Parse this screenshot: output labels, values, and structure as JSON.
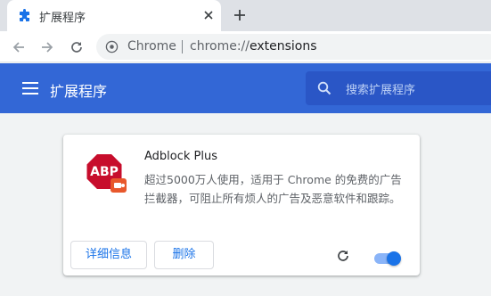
{
  "tab": {
    "title": "扩展程序"
  },
  "address_bar": {
    "chip_label": "Chrome",
    "url_scheme": "chrome://",
    "url_path": "extensions"
  },
  "extensions_page": {
    "title": "扩展程序",
    "search_placeholder": "搜索扩展程序"
  },
  "extension": {
    "name": "Adblock Plus",
    "description": "超过5000万人使用，适用于 Chrome 的免费的广告拦截器，可阻止所有烦人的广告及恶意软件和跟踪。",
    "logo_text": "ABP",
    "details_label": "详细信息",
    "remove_label": "删除",
    "enabled": true
  },
  "colors": {
    "header": "#3367d6",
    "accent": "#1a73e8",
    "abp_red": "#c70d2c"
  },
  "icons": [
    "puzzle-icon",
    "close-icon",
    "plus-icon",
    "back-arrow-icon",
    "forward-arrow-icon",
    "reload-icon",
    "chrome-icon",
    "menu-icon",
    "search-icon",
    "abp-logo",
    "reload-extension-icon"
  ]
}
